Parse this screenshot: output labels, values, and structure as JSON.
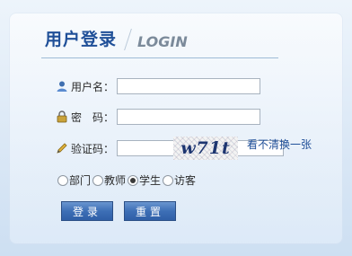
{
  "header": {
    "title_cn": "用户登录",
    "title_en": "LOGIN"
  },
  "form": {
    "username_label": "用户名：",
    "password_label": "密　码：",
    "captcha_label": "验证码：",
    "username_value": "",
    "password_value": "",
    "captcha_value": "",
    "captcha_image_text": "w71t",
    "refresh_text": "看不清换一张"
  },
  "roles": [
    {
      "label": "部门",
      "selected": false
    },
    {
      "label": "教师",
      "selected": false
    },
    {
      "label": "学生",
      "selected": true
    },
    {
      "label": "访客",
      "selected": false
    }
  ],
  "buttons": {
    "login": "登录",
    "reset": "重置"
  },
  "icons": {
    "user": "user-icon",
    "lock": "lock-icon",
    "pencil": "pencil-icon"
  },
  "colors": {
    "brand_blue": "#1f4f98",
    "button_blue": "#3d6fb6"
  }
}
